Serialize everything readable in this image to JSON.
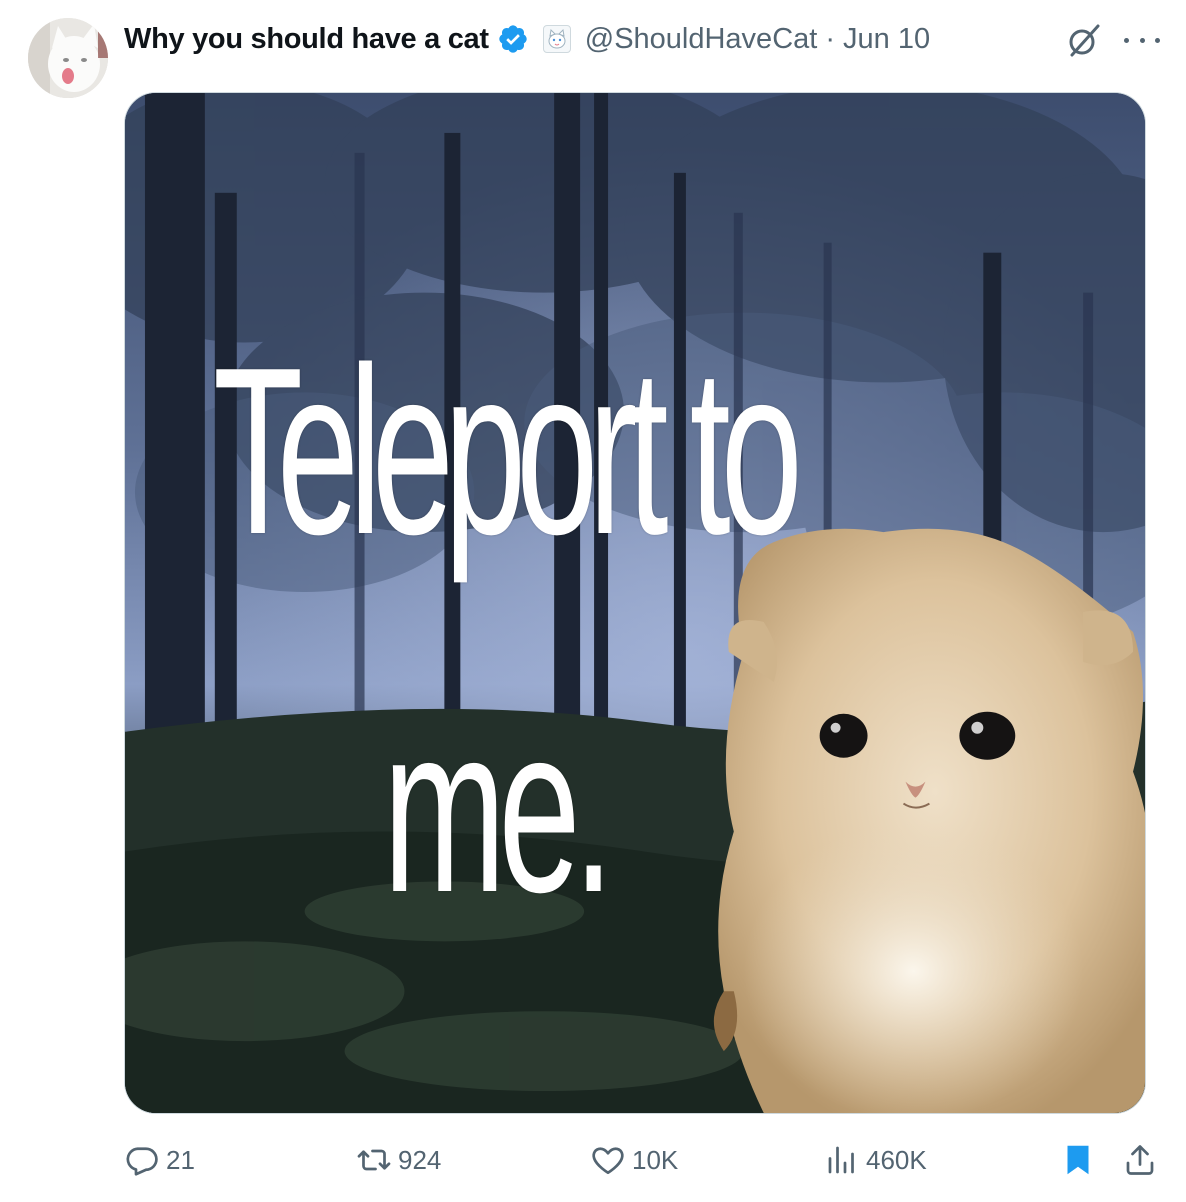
{
  "tweet": {
    "display_name": "Why you should have a cat",
    "verified": true,
    "affiliate_badge_icon": "cat-affiliate-badge-icon",
    "handle": "@ShouldHaveCat",
    "separator": "·",
    "date": "Jun 10",
    "avatar_icon": "white-cat-avatar",
    "media": {
      "line1": "Teleport to",
      "line2": "me.",
      "kind": "meme-image-foggy-forest-kitten"
    }
  },
  "actions": {
    "reply_count": "21",
    "repost_count": "924",
    "like_count": "10K",
    "views_count": "460K"
  },
  "colors": {
    "text_primary": "#0f1419",
    "text_secondary": "#536471",
    "verified_blue": "#1d9bf0",
    "bookmark_blue": "#1d9bf0",
    "border": "#cfd9de"
  }
}
